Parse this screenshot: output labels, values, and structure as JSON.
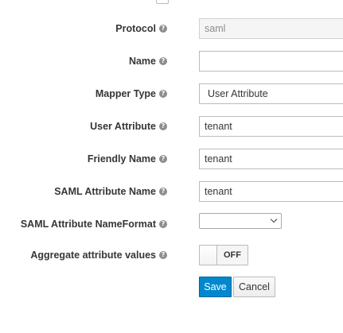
{
  "form": {
    "protocol": {
      "label": "Protocol",
      "value": "saml"
    },
    "name": {
      "label": "Name",
      "value": ""
    },
    "mapper_type": {
      "label": "Mapper Type",
      "value": "User Attribute"
    },
    "user_attribute": {
      "label": "User Attribute",
      "value": "tenant"
    },
    "friendly_name": {
      "label": "Friendly Name",
      "value": "tenant"
    },
    "saml_attribute_name": {
      "label": "SAML Attribute Name",
      "value": "tenant"
    },
    "saml_attribute_nameformat": {
      "label": "SAML Attribute NameFormat",
      "value": ""
    },
    "aggregate_attribute_values": {
      "label": "Aggregate attribute values",
      "toggle_state": "OFF"
    }
  },
  "actions": {
    "save_label": "Save",
    "cancel_label": "Cancel"
  },
  "icons": {
    "help": "question-circle-icon",
    "help_glyph": "?"
  },
  "colors": {
    "primary": "#0088ce",
    "label_text": "#363636",
    "help_icon": "#8b8d8f"
  }
}
